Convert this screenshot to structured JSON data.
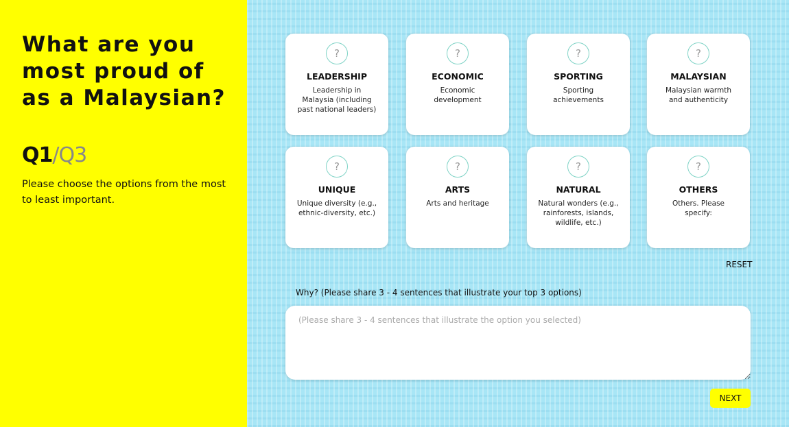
{
  "question": {
    "title": "What are you most proud of as a Malaysian?",
    "progress_current": "Q1",
    "progress_separator": "/",
    "progress_total": "Q3",
    "instruction": "Please choose the options from the most to least important."
  },
  "options": [
    {
      "icon": "?",
      "title": "LEADERSHIP",
      "description": "Leadership in Malaysia (including past national leaders)"
    },
    {
      "icon": "?",
      "title": "ECONOMIC",
      "description": "Economic development"
    },
    {
      "icon": "?",
      "title": "SPORTING",
      "description": "Sporting achievements"
    },
    {
      "icon": "?",
      "title": "MALAYSIAN",
      "description": "Malaysian warmth and authenticity"
    },
    {
      "icon": "?",
      "title": "UNIQUE",
      "description": "Unique diversity (e.g., ethnic-diversity, etc.)"
    },
    {
      "icon": "?",
      "title": "ARTS",
      "description": "Arts and heritage"
    },
    {
      "icon": "?",
      "title": "NATURAL",
      "description": "Natural wonders (e.g., rainforests, islands, wildlife, etc.)"
    },
    {
      "icon": "?",
      "title": "OTHERS",
      "description": "Others. Please specify:"
    }
  ],
  "controls": {
    "reset_label": "RESET",
    "why_label": "Why? (Please share 3 - 4 sentences that illustrate your top 3 options)",
    "why_placeholder": "(Please share 3 - 4 sentences that illustrate the option you selected)",
    "why_value": "",
    "next_label": "NEXT"
  },
  "colors": {
    "left_panel": "#ffff00",
    "right_panel": "#a8e6f6",
    "icon_ring": "#7fd3c6",
    "next_button": "#ffff00"
  }
}
